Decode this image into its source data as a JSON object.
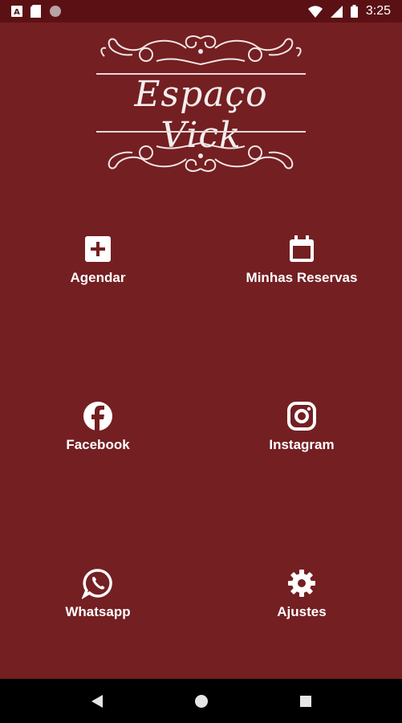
{
  "status_bar": {
    "time": "3:25",
    "left_icons": [
      "app-a-icon",
      "sim-card-icon",
      "circle-icon"
    ],
    "right_icons": [
      "wifi-icon",
      "signal-icon",
      "battery-icon"
    ]
  },
  "logo": {
    "title": "Espaço Vick"
  },
  "menu": {
    "agendar": "Agendar",
    "minhas_reservas": "Minhas Reservas",
    "facebook": "Facebook",
    "instagram": "Instagram",
    "whatsapp": "Whatsapp",
    "ajustes": "Ajustes"
  },
  "nav_bar": {
    "back_icon": "back-icon",
    "home_icon": "home-icon",
    "recents_icon": "recents-icon"
  },
  "colors": {
    "background": "#741f22",
    "status_bar": "#5b1114",
    "nav_bar": "#000000",
    "foreground": "#ffffff"
  }
}
